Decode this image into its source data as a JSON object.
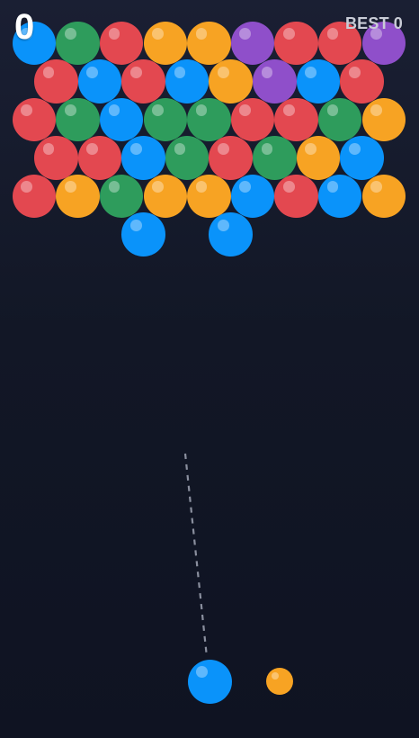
{
  "hud": {
    "score": "0",
    "best_label": "BEST",
    "best_value": "0"
  },
  "colors": {
    "blue": "#0a93fa",
    "green": "#2e9c5c",
    "red": "#e34850",
    "orange": "#f7a323",
    "purple": "#8f4fca",
    "aim_line": "#8a8f9e"
  },
  "grid": {
    "rows": [
      [
        "blue",
        "green",
        "red",
        "orange",
        "orange",
        "purple",
        "red",
        "red",
        "purple"
      ],
      [
        "red",
        "blue",
        "red",
        "blue",
        "orange",
        "purple",
        "blue",
        "red"
      ],
      [
        "red",
        "green",
        "blue",
        "green",
        "green",
        "red",
        "red",
        "green",
        "orange"
      ],
      [
        "red",
        "red",
        "blue",
        "green",
        "red",
        "green",
        "orange",
        "blue"
      ],
      [
        "red",
        "orange",
        "green",
        "orange",
        "orange",
        "blue",
        "red",
        "blue",
        "orange"
      ],
      [
        null,
        null,
        "blue",
        null,
        "blue",
        null,
        null,
        null
      ]
    ]
  },
  "shooter": {
    "current": "blue",
    "next": "orange"
  }
}
